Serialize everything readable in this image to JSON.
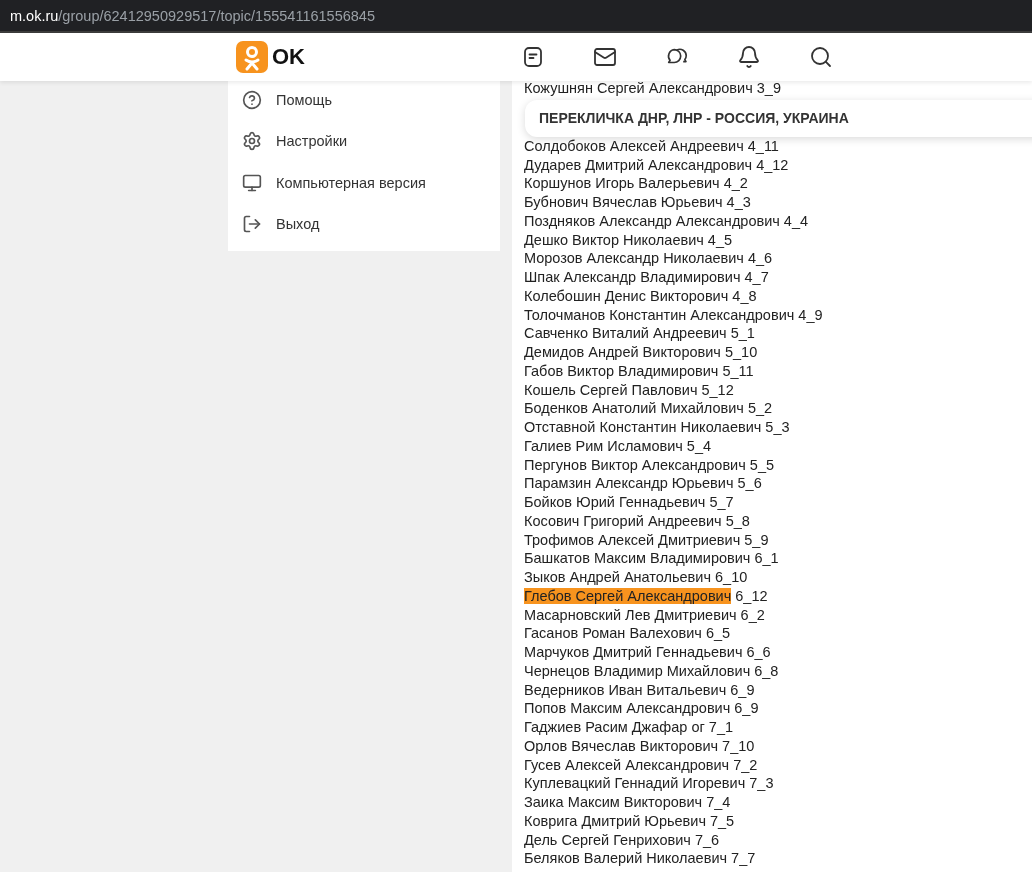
{
  "address_bar": {
    "host": "m.ok.ru",
    "path": "/group/62412950929517/topic/155541161556845"
  },
  "header": {
    "logo_text": "OK"
  },
  "menu": [
    {
      "kind": "help",
      "label": "Помощь"
    },
    {
      "kind": "settings",
      "label": "Настройки"
    },
    {
      "kind": "desktop",
      "label": "Компьютерная версия"
    },
    {
      "kind": "logout",
      "label": "Выход"
    }
  ],
  "topic_title": "ПЕРЕКЛИЧКА ДНР, ЛНР - РОССИЯ, УКРАИНА",
  "rows": [
    {
      "name": "Кожушнян Сергей Александрович",
      "code": "3_9",
      "highlighted": false
    },
    {
      "name": "Солдобоков Алексей Андреевич",
      "code": "4_11",
      "highlighted": false
    },
    {
      "name": "Дударев Дмитрий Александрович",
      "code": "4_12",
      "highlighted": false
    },
    {
      "name": "Коршунов Игорь Валерьевич",
      "code": "4_2",
      "highlighted": false
    },
    {
      "name": "Бубнович Вячеслав Юрьевич",
      "code": "4_3",
      "highlighted": false
    },
    {
      "name": "Поздняков Александр Александрович",
      "code": "4_4",
      "highlighted": false
    },
    {
      "name": "Дешко Виктор Николаевич",
      "code": "4_5",
      "highlighted": false
    },
    {
      "name": "Морозов Александр Николаевич",
      "code": "4_6",
      "highlighted": false
    },
    {
      "name": "Шпак Александр Владимирович",
      "code": "4_7",
      "highlighted": false
    },
    {
      "name": "Колебошин Денис Викторович",
      "code": "4_8",
      "highlighted": false
    },
    {
      "name": "Толочманов Константин Александрович",
      "code": "4_9",
      "highlighted": false
    },
    {
      "name": "Савченко Виталий Андреевич",
      "code": "5_1",
      "highlighted": false
    },
    {
      "name": "Демидов Андрей Викторович",
      "code": "5_10",
      "highlighted": false
    },
    {
      "name": "Габов Виктор Владимирович",
      "code": "5_11",
      "highlighted": false
    },
    {
      "name": "Кошель Сергей Павлович",
      "code": "5_12",
      "highlighted": false
    },
    {
      "name": "Боденков Анатолий Михайлович",
      "code": "5_2",
      "highlighted": false
    },
    {
      "name": "Отставной Константин Николаевич",
      "code": "5_3",
      "highlighted": false
    },
    {
      "name": "Галиев Рим Исламович",
      "code": "5_4",
      "highlighted": false
    },
    {
      "name": "Пергунов Виктор Александрович",
      "code": "5_5",
      "highlighted": false
    },
    {
      "name": "Парамзин Александр Юрьевич",
      "code": "5_6",
      "highlighted": false
    },
    {
      "name": "Бойков Юрий Геннадьевич",
      "code": "5_7",
      "highlighted": false
    },
    {
      "name": "Косович Григорий Андреевич",
      "code": "5_8",
      "highlighted": false
    },
    {
      "name": "Трофимов Алексей Дмитриевич",
      "code": "5_9",
      "highlighted": false
    },
    {
      "name": "Башкатов Максим Владимирович",
      "code": "6_1",
      "highlighted": false
    },
    {
      "name": "Зыков Андрей Анатольевич",
      "code": "6_10",
      "highlighted": false
    },
    {
      "name": "Глебов Сергей Александрович",
      "code": "6_12",
      "highlighted": true
    },
    {
      "name": "Масарновский Лев Дмитриевич",
      "code": "6_2",
      "highlighted": false
    },
    {
      "name": "Гасанов Роман Валехович",
      "code": "6_5",
      "highlighted": false
    },
    {
      "name": "Марчуков Дмитрий Геннадьевич",
      "code": "6_6",
      "highlighted": false
    },
    {
      "name": "Чернецов Владимир Михайлович",
      "code": "6_8",
      "highlighted": false
    },
    {
      "name": "Ведерников Иван Витальевич",
      "code": "6_9",
      "highlighted": false
    },
    {
      "name": "Попов Максим Александрович",
      "code": "6_9",
      "highlighted": false
    },
    {
      "name": "Гаджиев Расим Джафар ог",
      "code": "7_1",
      "highlighted": false
    },
    {
      "name": "Орлов Вячеслав Викторович",
      "code": "7_10",
      "highlighted": false
    },
    {
      "name": "Гусев Алексей Александрович",
      "code": "7_2",
      "highlighted": false
    },
    {
      "name": "Куплевацкий Геннадий Игоревич",
      "code": "7_3",
      "highlighted": false
    },
    {
      "name": "Заика Максим Викторович",
      "code": "7_4",
      "highlighted": false
    },
    {
      "name": "Коврига Дмитрий Юрьевич",
      "code": "7_5",
      "highlighted": false
    },
    {
      "name": "Дель Сергей Генрихович",
      "code": "7_6",
      "highlighted": false
    },
    {
      "name": "Беляков Валерий Николаевич",
      "code": "7_7",
      "highlighted": false
    }
  ]
}
